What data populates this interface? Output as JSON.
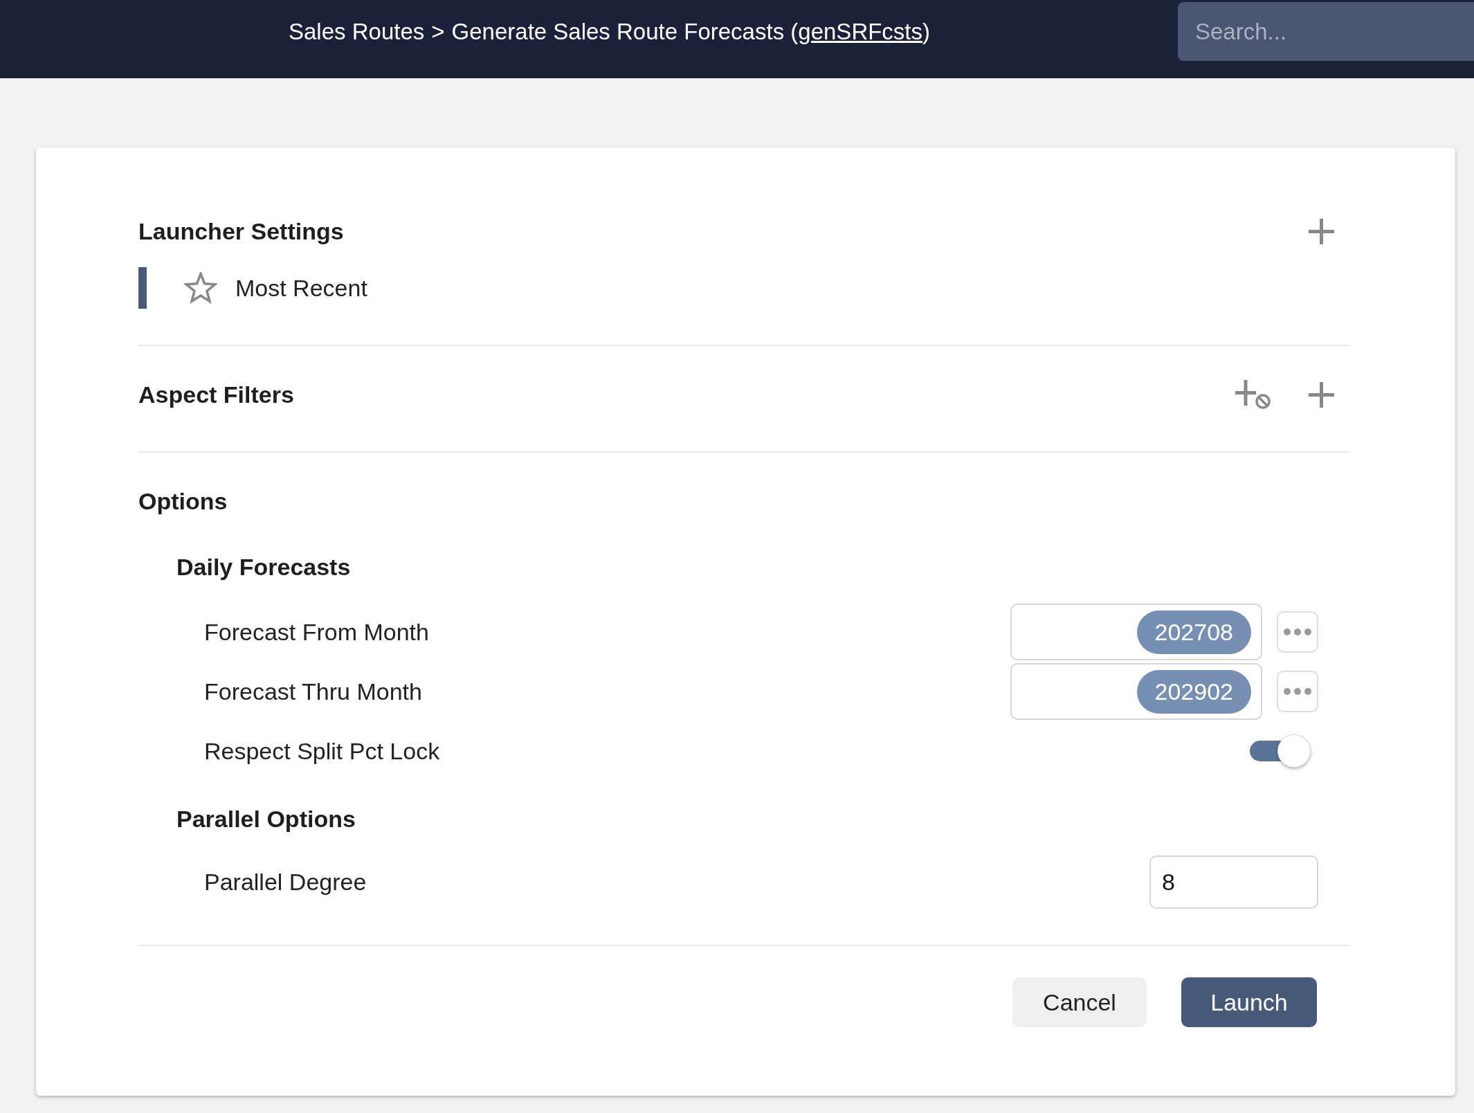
{
  "header": {
    "breadcrumb": {
      "parent": "Sales Routes",
      "separator": ">",
      "title_before": "Generate Sales Route Forecasts (",
      "title_link": "genSRFcsts",
      "title_after": ")"
    },
    "search": {
      "placeholder": "Search..."
    }
  },
  "sections": [
    {
      "title": "Launcher Settings",
      "actions": [
        {
          "kind": "add"
        }
      ],
      "items": [
        {
          "label": "Most Recent",
          "selected": true,
          "starred": false
        }
      ]
    },
    {
      "title": "Aspect Filters",
      "actions": [
        {
          "kind": "add-exclusion"
        },
        {
          "kind": "add"
        }
      ]
    },
    {
      "title": "Options",
      "groups": [
        {
          "title": "Daily Forecasts",
          "fields": [
            {
              "kind": "lookup",
              "label": "Forecast From Month",
              "value": "202708"
            },
            {
              "kind": "lookup",
              "label": "Forecast Thru Month",
              "value": "202902"
            },
            {
              "kind": "toggle",
              "label": "Respect Split Pct Lock",
              "on": true
            }
          ]
        },
        {
          "title": "Parallel Options",
          "fields": [
            {
              "kind": "number",
              "label": "Parallel Degree",
              "value": "8"
            }
          ]
        }
      ]
    }
  ],
  "buttons": [
    {
      "kind": "secondary",
      "label": "Cancel"
    },
    {
      "kind": "primary",
      "label": "Launch"
    }
  ]
}
